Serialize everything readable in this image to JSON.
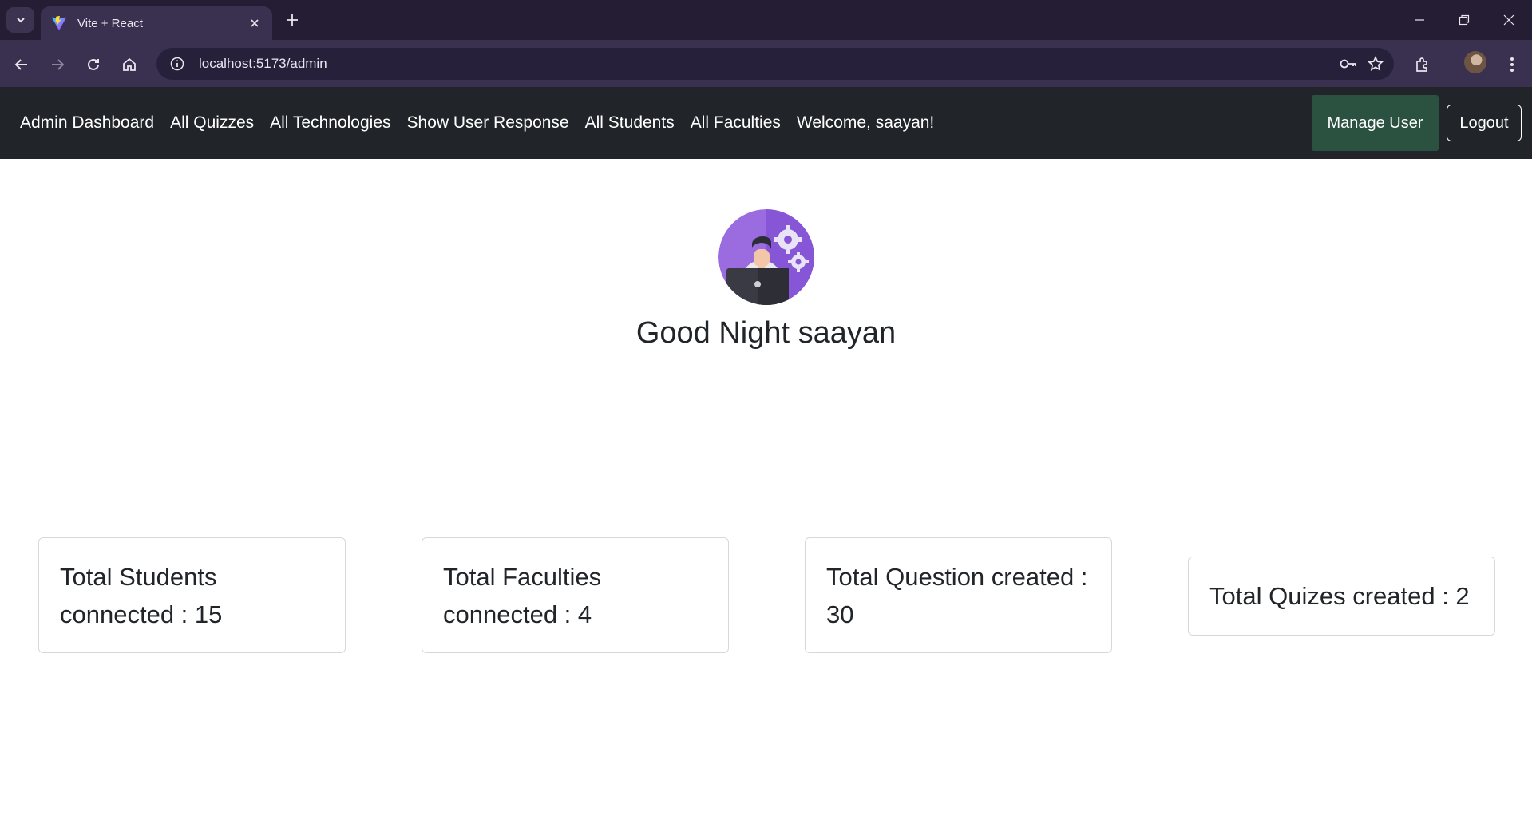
{
  "browser": {
    "tab_title": "Vite + React",
    "url": "localhost:5173/admin"
  },
  "navbar": {
    "links": [
      "Admin Dashboard",
      "All Quizzes",
      "All Technologies",
      "Show User Response",
      "All Students",
      "All Faculties"
    ],
    "welcome": "Welcome, saayan!",
    "manage_user": "Manage User",
    "logout": "Logout"
  },
  "hero": {
    "greeting": "Good Night saayan"
  },
  "stats": [
    {
      "label": "Total Students connected : 15"
    },
    {
      "label": "Total Faculties connected : 4"
    },
    {
      "label": "Total Question created : 30"
    },
    {
      "label": "Total Quizes created : 2"
    }
  ],
  "colors": {
    "navbar_bg": "#212529",
    "manage_user_bg": "#2b5141",
    "tabstrip_bg": "#241d33",
    "toolbar_bg": "#3a3150"
  }
}
